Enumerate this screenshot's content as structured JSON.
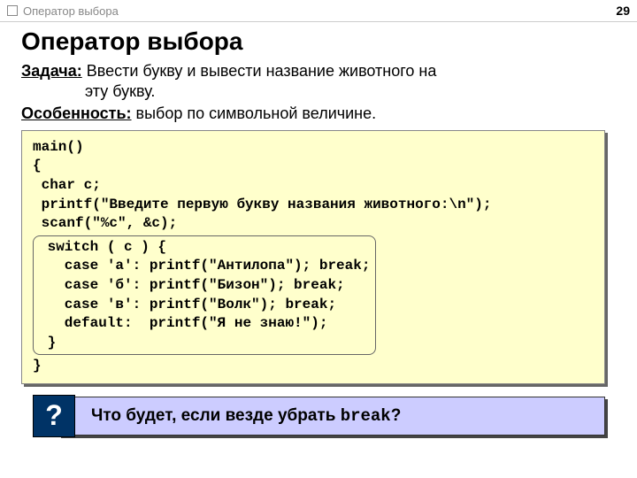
{
  "header": {
    "tab_title": "Оператор выбора",
    "page_number": "29"
  },
  "title": "Оператор выбора",
  "task": {
    "label": "Задача:",
    "line1": " Ввести букву и вывести название животного на",
    "line2": "эту букву."
  },
  "note": {
    "label": "Особенность:",
    "text": " выбор по символьной величине."
  },
  "code": {
    "l1": "main()",
    "l2": "{",
    "l3": " char c;",
    "l4": " printf(\"Введите первую букву названия животного:\\n\");",
    "l5": " scanf(\"%c\", &c);",
    "s1": " switch ( c ) {",
    "s2": "   case 'а': printf(\"Антилопа\"); break;",
    "s3": "   case 'б': printf(\"Бизон\"); break;",
    "s4": "   case 'в': printf(\"Волк\"); break;",
    "s5": "   default:  printf(\"Я не знаю!\");",
    "s6": " }",
    "l6": "}"
  },
  "question": {
    "mark": "?",
    "text_before": "Что будет, если везде убрать ",
    "mono": "break",
    "text_after": "?"
  }
}
